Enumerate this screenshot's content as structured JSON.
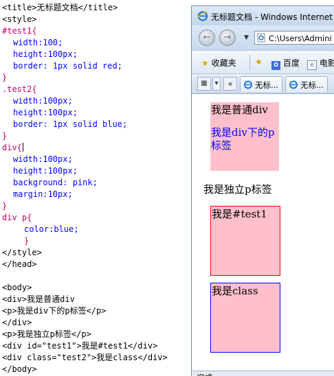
{
  "editor": {
    "lines": [
      {
        "text": "<title>无标题文档</title>",
        "type": "tag",
        "indent": 0
      },
      {
        "text": "<style>",
        "type": "tag",
        "indent": 0
      },
      {
        "text": "#test1{",
        "type": "sel",
        "indent": 0
      },
      {
        "text": "width:100;",
        "type": "prop",
        "indent": 1
      },
      {
        "text": "height:100px;",
        "type": "prop",
        "indent": 1
      },
      {
        "text": "border: 1px solid red;",
        "type": "prop",
        "indent": 1
      },
      {
        "text": "}",
        "type": "sel",
        "indent": 0
      },
      {
        "text": ".test2{",
        "type": "sel",
        "indent": 0
      },
      {
        "text": "width:100px;",
        "type": "prop",
        "indent": 1
      },
      {
        "text": "height:100px;",
        "type": "prop",
        "indent": 1
      },
      {
        "text": "border: 1px solid blue;",
        "type": "prop",
        "indent": 1
      },
      {
        "text": "}",
        "type": "sel",
        "indent": 0
      },
      {
        "text": "div{",
        "type": "sel",
        "indent": 0,
        "cursor": true
      },
      {
        "text": "width:100px;",
        "type": "prop",
        "indent": 1
      },
      {
        "text": "height:100px;",
        "type": "prop",
        "indent": 1
      },
      {
        "text": "background: pink;",
        "type": "prop",
        "indent": 1
      },
      {
        "text": "margin:10px;",
        "type": "prop",
        "indent": 1
      },
      {
        "text": "}",
        "type": "sel",
        "indent": 0
      },
      {
        "text": "div p{",
        "type": "sel",
        "indent": 0
      },
      {
        "text": "color:blue;",
        "type": "prop",
        "indent": 2
      },
      {
        "text": "}",
        "type": "sel",
        "indent": 2
      },
      {
        "text": "</style>",
        "type": "tag",
        "indent": 0
      },
      {
        "text": "</head>",
        "type": "tag",
        "indent": 0
      },
      {
        "text": "",
        "type": "tag",
        "indent": 0
      },
      {
        "text": "<body>",
        "type": "tag",
        "indent": 0
      },
      {
        "text": "<div>我是普通div",
        "type": "tag",
        "indent": 0
      },
      {
        "text": "<p>我是div下的p标签</p>",
        "type": "tag",
        "indent": 0
      },
      {
        "text": "</div>",
        "type": "tag",
        "indent": 0
      },
      {
        "text": "<p>我是独立p标签</p>",
        "type": "tag",
        "indent": 0
      },
      {
        "text": "<div id=\"test1\">我是#test1</div>",
        "type": "tag",
        "indent": 0
      },
      {
        "text": "<div class=\"test2\">我是class</div>",
        "type": "tag",
        "indent": 0
      },
      {
        "text": "</body>",
        "type": "tag",
        "indent": 0
      }
    ]
  },
  "browser": {
    "window_title": "无标题文档 - Windows Internet",
    "address": "C:\\Users\\Admini",
    "favorites_label": "收藏夹",
    "fav_baidu": "百度",
    "fav_dian": "电影",
    "tab_overflow": "«",
    "tabs": [
      {
        "label": "无标..."
      },
      {
        "label": "无标..."
      }
    ],
    "status": "完成",
    "colors": {
      "pink": "#ffc0cb",
      "red": "#ff0000",
      "blue": "#0000ff"
    }
  },
  "page": {
    "div_text": "我是普通div",
    "div_p_text": "我是div下的p标签",
    "standalone_p": "我是独立p标签",
    "test1_text": "我是#test1",
    "test2_text": "我是class"
  }
}
